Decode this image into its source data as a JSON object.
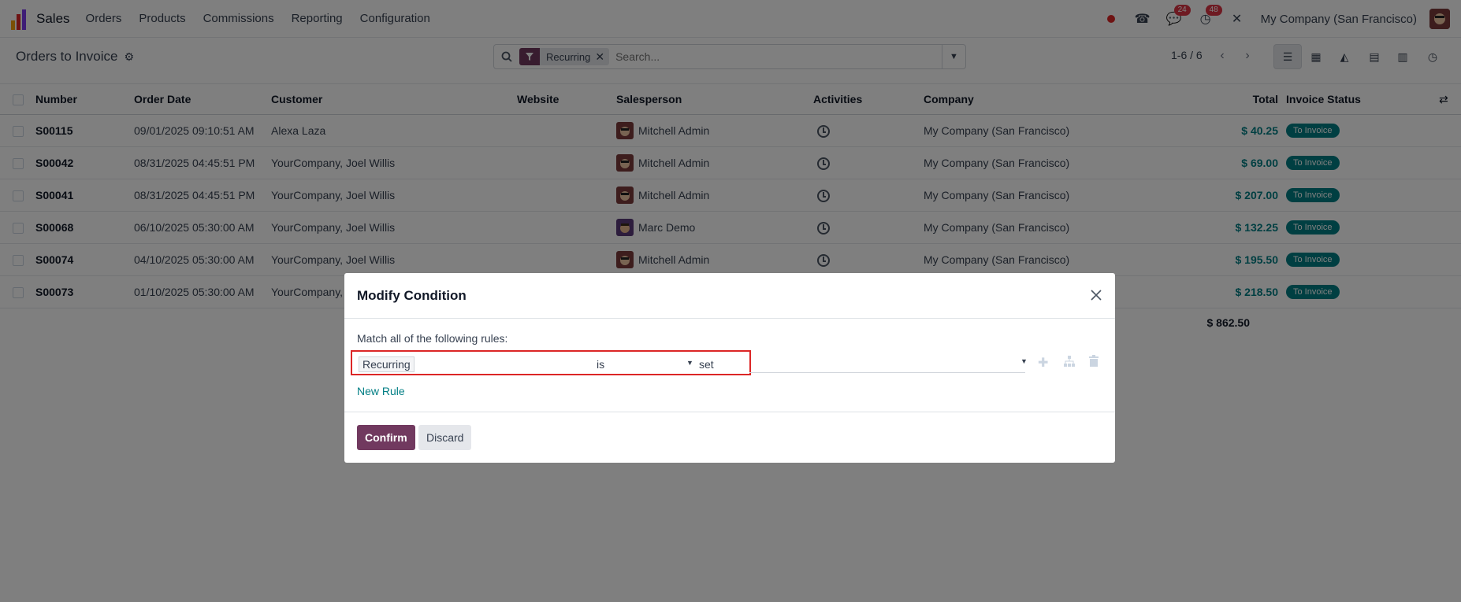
{
  "navbar": {
    "app_name": "Sales",
    "menu": [
      "Orders",
      "Products",
      "Commissions",
      "Reporting",
      "Configuration"
    ],
    "badges": {
      "messages": "24",
      "activities": "48"
    },
    "company": "My Company (San Francisco)"
  },
  "control_panel": {
    "title": "Orders to Invoice",
    "search": {
      "facet": "Recurring",
      "placeholder": "Search..."
    },
    "pager": "1-6 / 6"
  },
  "table": {
    "headers": {
      "number": "Number",
      "order_date": "Order Date",
      "customer": "Customer",
      "website": "Website",
      "salesperson": "Salesperson",
      "activities": "Activities",
      "company": "Company",
      "total": "Total",
      "invoice_status": "Invoice Status"
    },
    "rows": [
      {
        "number": "S00115",
        "date": "09/01/2025 09:10:51 AM",
        "customer": "Alexa Laza",
        "salesperson": "Mitchell Admin",
        "company": "My Company (San Francisco)",
        "total": "$ 40.25",
        "status": "To Invoice"
      },
      {
        "number": "S00042",
        "date": "08/31/2025 04:45:51 PM",
        "customer": "YourCompany, Joel Willis",
        "salesperson": "Mitchell Admin",
        "company": "My Company (San Francisco)",
        "total": "$ 69.00",
        "status": "To Invoice"
      },
      {
        "number": "S00041",
        "date": "08/31/2025 04:45:51 PM",
        "customer": "YourCompany, Joel Willis",
        "salesperson": "Mitchell Admin",
        "company": "My Company (San Francisco)",
        "total": "$ 207.00",
        "status": "To Invoice"
      },
      {
        "number": "S00068",
        "date": "06/10/2025 05:30:00 AM",
        "customer": "YourCompany, Joel Willis",
        "salesperson": "Marc Demo",
        "company": "My Company (San Francisco)",
        "total": "$ 132.25",
        "status": "To Invoice"
      },
      {
        "number": "S00074",
        "date": "04/10/2025 05:30:00 AM",
        "customer": "YourCompany, Joel Willis",
        "salesperson": "Mitchell Admin",
        "company": "My Company (San Francisco)",
        "total": "$ 195.50",
        "status": "To Invoice"
      },
      {
        "number": "S00073",
        "date": "01/10/2025 05:30:00 AM",
        "customer": "YourCompany,",
        "salesperson": "",
        "company": "",
        "total": "$ 218.50",
        "status": "To Invoice"
      }
    ],
    "grand_total": "$ 862.50"
  },
  "dialog": {
    "title": "Modify Condition",
    "match_text": "Match all of the following rules:",
    "rule": {
      "field": "Recurring",
      "operator": "is",
      "value": "set"
    },
    "new_rule": "New Rule",
    "confirm": "Confirm",
    "discard": "Discard"
  },
  "colors": {
    "brand": "#71395f",
    "accent": "#017e84",
    "highlight": "#dc2626"
  }
}
